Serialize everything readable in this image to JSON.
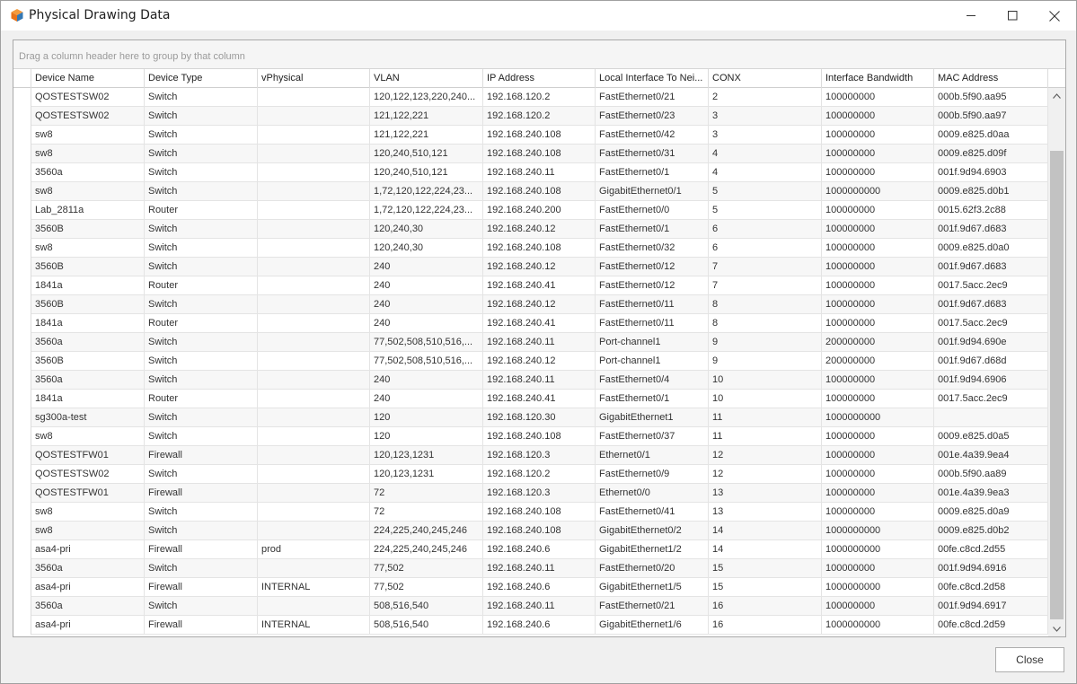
{
  "window": {
    "title": "Physical Drawing Data",
    "icon": "cube-icon"
  },
  "grid": {
    "group_panel_text": "Drag a column header here to group by that column",
    "columns": [
      "Device Name",
      "Device Type",
      "vPhysical",
      "VLAN",
      "IP Address",
      "Local Interface To Nei...",
      "CONX",
      "Interface Bandwidth",
      "MAC Address"
    ],
    "rows": [
      [
        "QOSTESTSW02",
        "Switch",
        "",
        "120,122,123,220,240...",
        "192.168.120.2",
        "FastEthernet0/21",
        "2",
        "100000000",
        "000b.5f90.aa95"
      ],
      [
        "QOSTESTSW02",
        "Switch",
        "",
        "121,122,221",
        "192.168.120.2",
        "FastEthernet0/23",
        "3",
        "100000000",
        "000b.5f90.aa97"
      ],
      [
        "sw8",
        "Switch",
        "",
        "121,122,221",
        "192.168.240.108",
        "FastEthernet0/42",
        "3",
        "100000000",
        "0009.e825.d0aa"
      ],
      [
        "sw8",
        "Switch",
        "",
        "120,240,510,121",
        "192.168.240.108",
        "FastEthernet0/31",
        "4",
        "100000000",
        "0009.e825.d09f"
      ],
      [
        "3560a",
        "Switch",
        "",
        "120,240,510,121",
        "192.168.240.11",
        "FastEthernet0/1",
        "4",
        "100000000",
        "001f.9d94.6903"
      ],
      [
        "sw8",
        "Switch",
        "",
        "1,72,120,122,224,23...",
        "192.168.240.108",
        "GigabitEthernet0/1",
        "5",
        "1000000000",
        "0009.e825.d0b1"
      ],
      [
        "Lab_2811a",
        "Router",
        "",
        "1,72,120,122,224,23...",
        "192.168.240.200",
        "FastEthernet0/0",
        "5",
        "100000000",
        "0015.62f3.2c88"
      ],
      [
        "3560B",
        "Switch",
        "",
        "120,240,30",
        "192.168.240.12",
        "FastEthernet0/1",
        "6",
        "100000000",
        "001f.9d67.d683"
      ],
      [
        "sw8",
        "Switch",
        "",
        "120,240,30",
        "192.168.240.108",
        "FastEthernet0/32",
        "6",
        "100000000",
        "0009.e825.d0a0"
      ],
      [
        "3560B",
        "Switch",
        "",
        "240",
        "192.168.240.12",
        "FastEthernet0/12",
        "7",
        "100000000",
        "001f.9d67.d683"
      ],
      [
        "1841a",
        "Router",
        "",
        "240",
        "192.168.240.41",
        "FastEthernet0/12",
        "7",
        "100000000",
        "0017.5acc.2ec9"
      ],
      [
        "3560B",
        "Switch",
        "",
        "240",
        "192.168.240.12",
        "FastEthernet0/11",
        "8",
        "100000000",
        "001f.9d67.d683"
      ],
      [
        "1841a",
        "Router",
        "",
        "240",
        "192.168.240.41",
        "FastEthernet0/11",
        "8",
        "100000000",
        "0017.5acc.2ec9"
      ],
      [
        "3560a",
        "Switch",
        "",
        "77,502,508,510,516,...",
        "192.168.240.11",
        "Port-channel1",
        "9",
        "200000000",
        "001f.9d94.690e"
      ],
      [
        "3560B",
        "Switch",
        "",
        "77,502,508,510,516,...",
        "192.168.240.12",
        "Port-channel1",
        "9",
        "200000000",
        "001f.9d67.d68d"
      ],
      [
        "3560a",
        "Switch",
        "",
        "240",
        "192.168.240.11",
        "FastEthernet0/4",
        "10",
        "100000000",
        "001f.9d94.6906"
      ],
      [
        "1841a",
        "Router",
        "",
        "240",
        "192.168.240.41",
        "FastEthernet0/1",
        "10",
        "100000000",
        "0017.5acc.2ec9"
      ],
      [
        "sg300a-test",
        "Switch",
        "",
        "120",
        "192.168.120.30",
        "GigabitEthernet1",
        "11",
        "1000000000",
        ""
      ],
      [
        "sw8",
        "Switch",
        "",
        "120",
        "192.168.240.108",
        "FastEthernet0/37",
        "11",
        "100000000",
        "0009.e825.d0a5"
      ],
      [
        "QOSTESTFW01",
        "Firewall",
        "",
        "120,123,1231",
        "192.168.120.3",
        "Ethernet0/1",
        "12",
        "100000000",
        "001e.4a39.9ea4"
      ],
      [
        "QOSTESTSW02",
        "Switch",
        "",
        "120,123,1231",
        "192.168.120.2",
        "FastEthernet0/9",
        "12",
        "100000000",
        "000b.5f90.aa89"
      ],
      [
        "QOSTESTFW01",
        "Firewall",
        "",
        "72",
        "192.168.120.3",
        "Ethernet0/0",
        "13",
        "100000000",
        "001e.4a39.9ea3"
      ],
      [
        "sw8",
        "Switch",
        "",
        "72",
        "192.168.240.108",
        "FastEthernet0/41",
        "13",
        "100000000",
        "0009.e825.d0a9"
      ],
      [
        "sw8",
        "Switch",
        "",
        "224,225,240,245,246",
        "192.168.240.108",
        "GigabitEthernet0/2",
        "14",
        "1000000000",
        "0009.e825.d0b2"
      ],
      [
        "asa4-pri",
        "Firewall",
        "prod",
        "224,225,240,245,246",
        "192.168.240.6",
        "GigabitEthernet1/2",
        "14",
        "1000000000",
        "00fe.c8cd.2d55"
      ],
      [
        "3560a",
        "Switch",
        "",
        "77,502",
        "192.168.240.11",
        "FastEthernet0/20",
        "15",
        "100000000",
        "001f.9d94.6916"
      ],
      [
        "asa4-pri",
        "Firewall",
        "INTERNAL",
        "77,502",
        "192.168.240.6",
        "GigabitEthernet1/5",
        "15",
        "1000000000",
        "00fe.c8cd.2d58"
      ],
      [
        "3560a",
        "Switch",
        "",
        "508,516,540",
        "192.168.240.11",
        "FastEthernet0/21",
        "16",
        "100000000",
        "001f.9d94.6917"
      ],
      [
        "asa4-pri",
        "Firewall",
        "INTERNAL",
        "508,516,540",
        "192.168.240.6",
        "GigabitEthernet1/6",
        "16",
        "1000000000",
        "00fe.c8cd.2d59"
      ]
    ]
  },
  "footer": {
    "close_label": "Close"
  },
  "colors": {
    "accent_icon": "#e8731a",
    "scroll_thumb": "#c2c2c2"
  }
}
